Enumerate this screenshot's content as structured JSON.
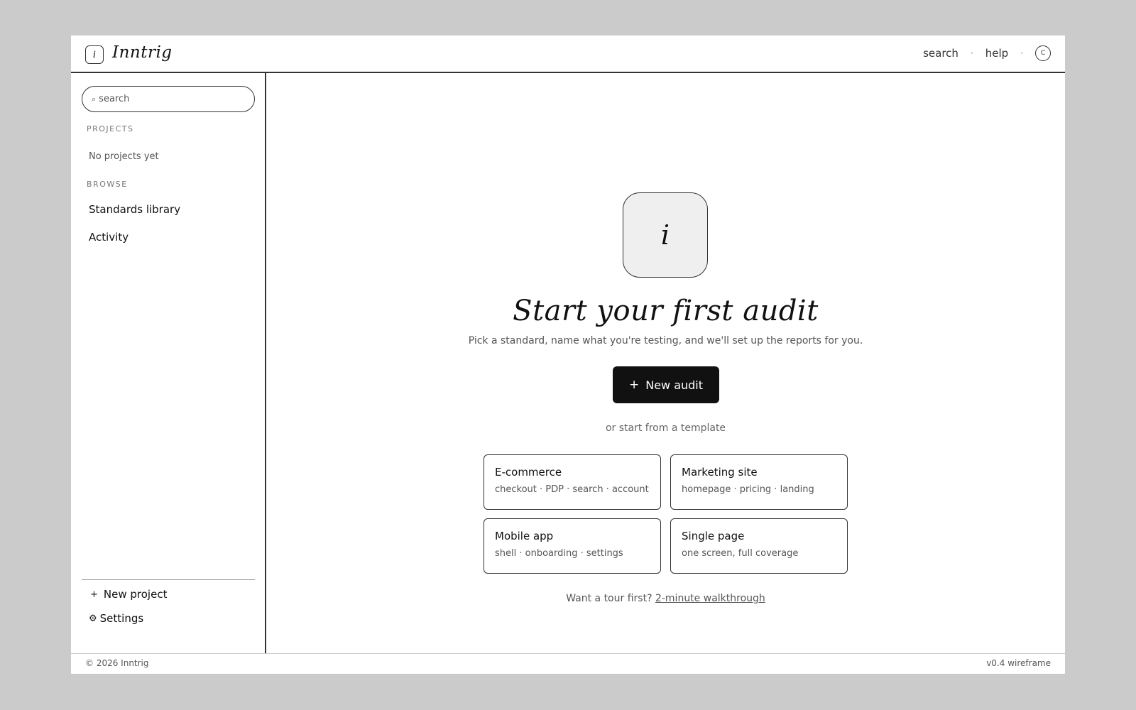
{
  "app": {
    "logo_glyph": "i",
    "name": "Inntrig"
  },
  "topnav": {
    "search_label": "search",
    "help_label": "help",
    "separator": "·",
    "avatar_initial": "C"
  },
  "sidebar": {
    "search_placeholder": "search",
    "search_icon": "⌕",
    "projects_heading": "PROJECTS",
    "projects_empty": "No projects yet",
    "browse_heading": "BROWSE",
    "browse_items": [
      {
        "label": "Standards library"
      },
      {
        "label": "Activity"
      }
    ],
    "new_project_icon": "+",
    "new_project_label": "New project",
    "settings_icon": "⚙",
    "settings_label": "Settings"
  },
  "main": {
    "hero_glyph": "i",
    "title": "Start your first audit",
    "subtitle": "Pick a standard, name what you're testing, and we'll set up the reports for you.",
    "primary_button_icon": "+",
    "primary_button_label": "New audit",
    "template_prompt": "or start from a template",
    "templates": [
      {
        "title": "E-commerce",
        "desc": "checkout · PDP · search · account"
      },
      {
        "title": "Marketing site",
        "desc": "homepage · pricing · landing"
      },
      {
        "title": "Mobile app",
        "desc": "shell · onboarding · settings"
      },
      {
        "title": "Single page",
        "desc": "one screen, full coverage"
      }
    ],
    "tour_prefix": "Want a tour first?",
    "tour_link": "2-minute walkthrough"
  },
  "footer": {
    "copyright": "© 2026 Inntrig",
    "version": "v0.4 wireframe"
  },
  "colors": {
    "page_background": "#cbcbcb",
    "surface": "#ffffff",
    "primary_button": "#111111",
    "hero_icon_fill": "#efefef"
  }
}
